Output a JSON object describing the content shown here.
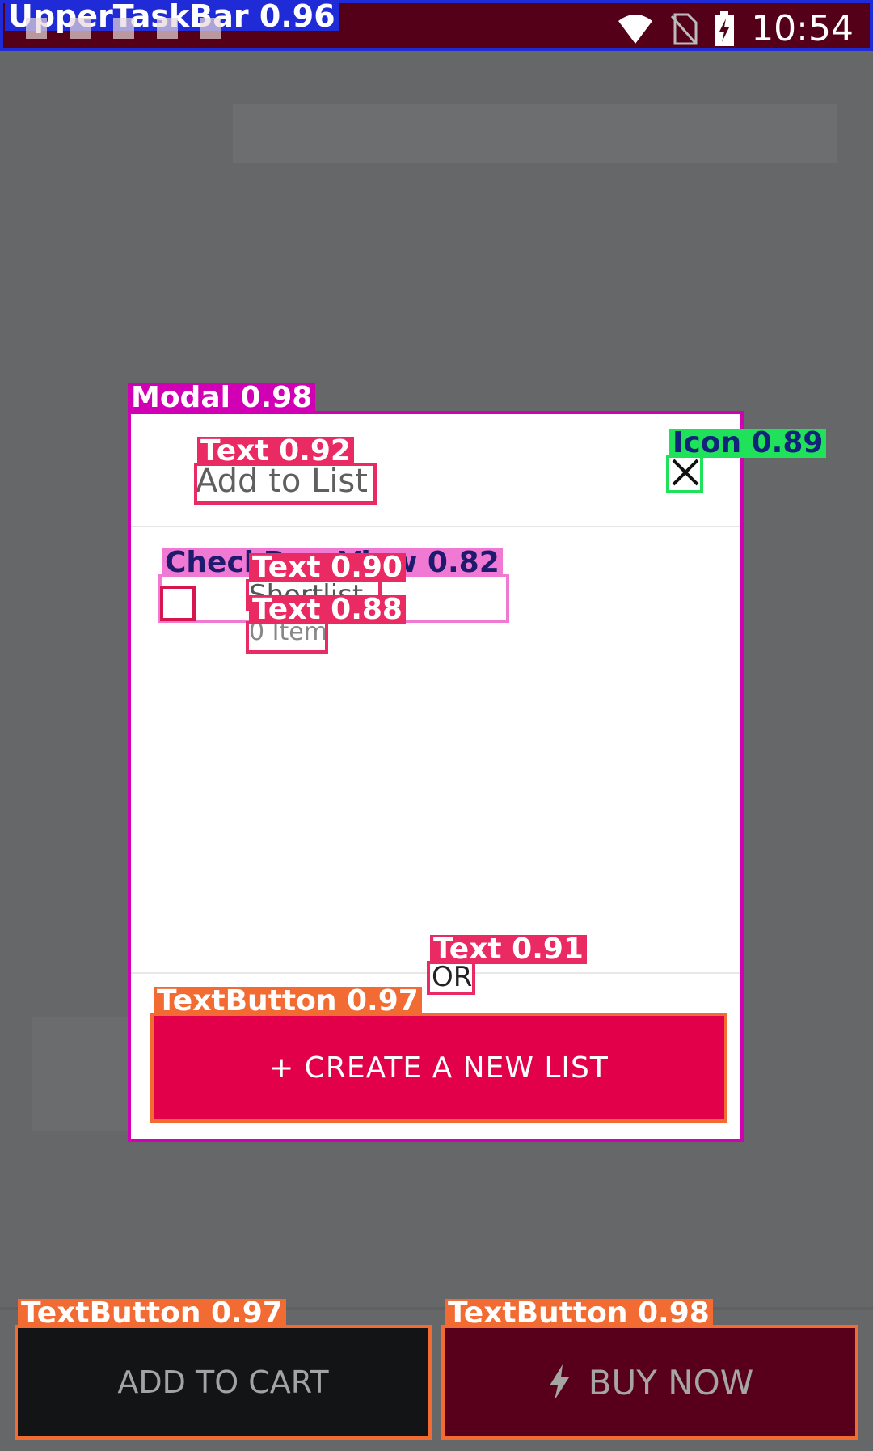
{
  "statusbar": {
    "detection_label": "UpperTaskBar 0.96",
    "time": "10:54"
  },
  "modal": {
    "detection_label": "Modal 0.98",
    "title": "Add to List",
    "title_detection_label": "Text 0.92",
    "close_icon_detection_label": "Icon 0.89",
    "list_item": {
      "detection_label": "CheckBox_View 0.82",
      "name": "Shortlist",
      "name_detection_label": "Text 0.90",
      "count": "0 Item",
      "count_detection_label": "Text 0.88"
    },
    "or_text": "OR",
    "or_detection_label": "Text 0.91",
    "create_button": {
      "label": "+  CREATE A NEW LIST",
      "detection_label": "TextButton 0.97"
    }
  },
  "bottom": {
    "add_to_cart": {
      "label": "ADD TO CART",
      "detection_label": "TextButton 0.97"
    },
    "buy_now": {
      "label": "BUY NOW",
      "detection_label": "TextButton 0.98"
    }
  },
  "colors": {
    "status_bar": "#540018",
    "accent": "#e2004a",
    "modal_box": "#d100b5",
    "text_box": "#ea2a62",
    "icon_box": "#1fe25a",
    "button_box": "#f26b33"
  }
}
